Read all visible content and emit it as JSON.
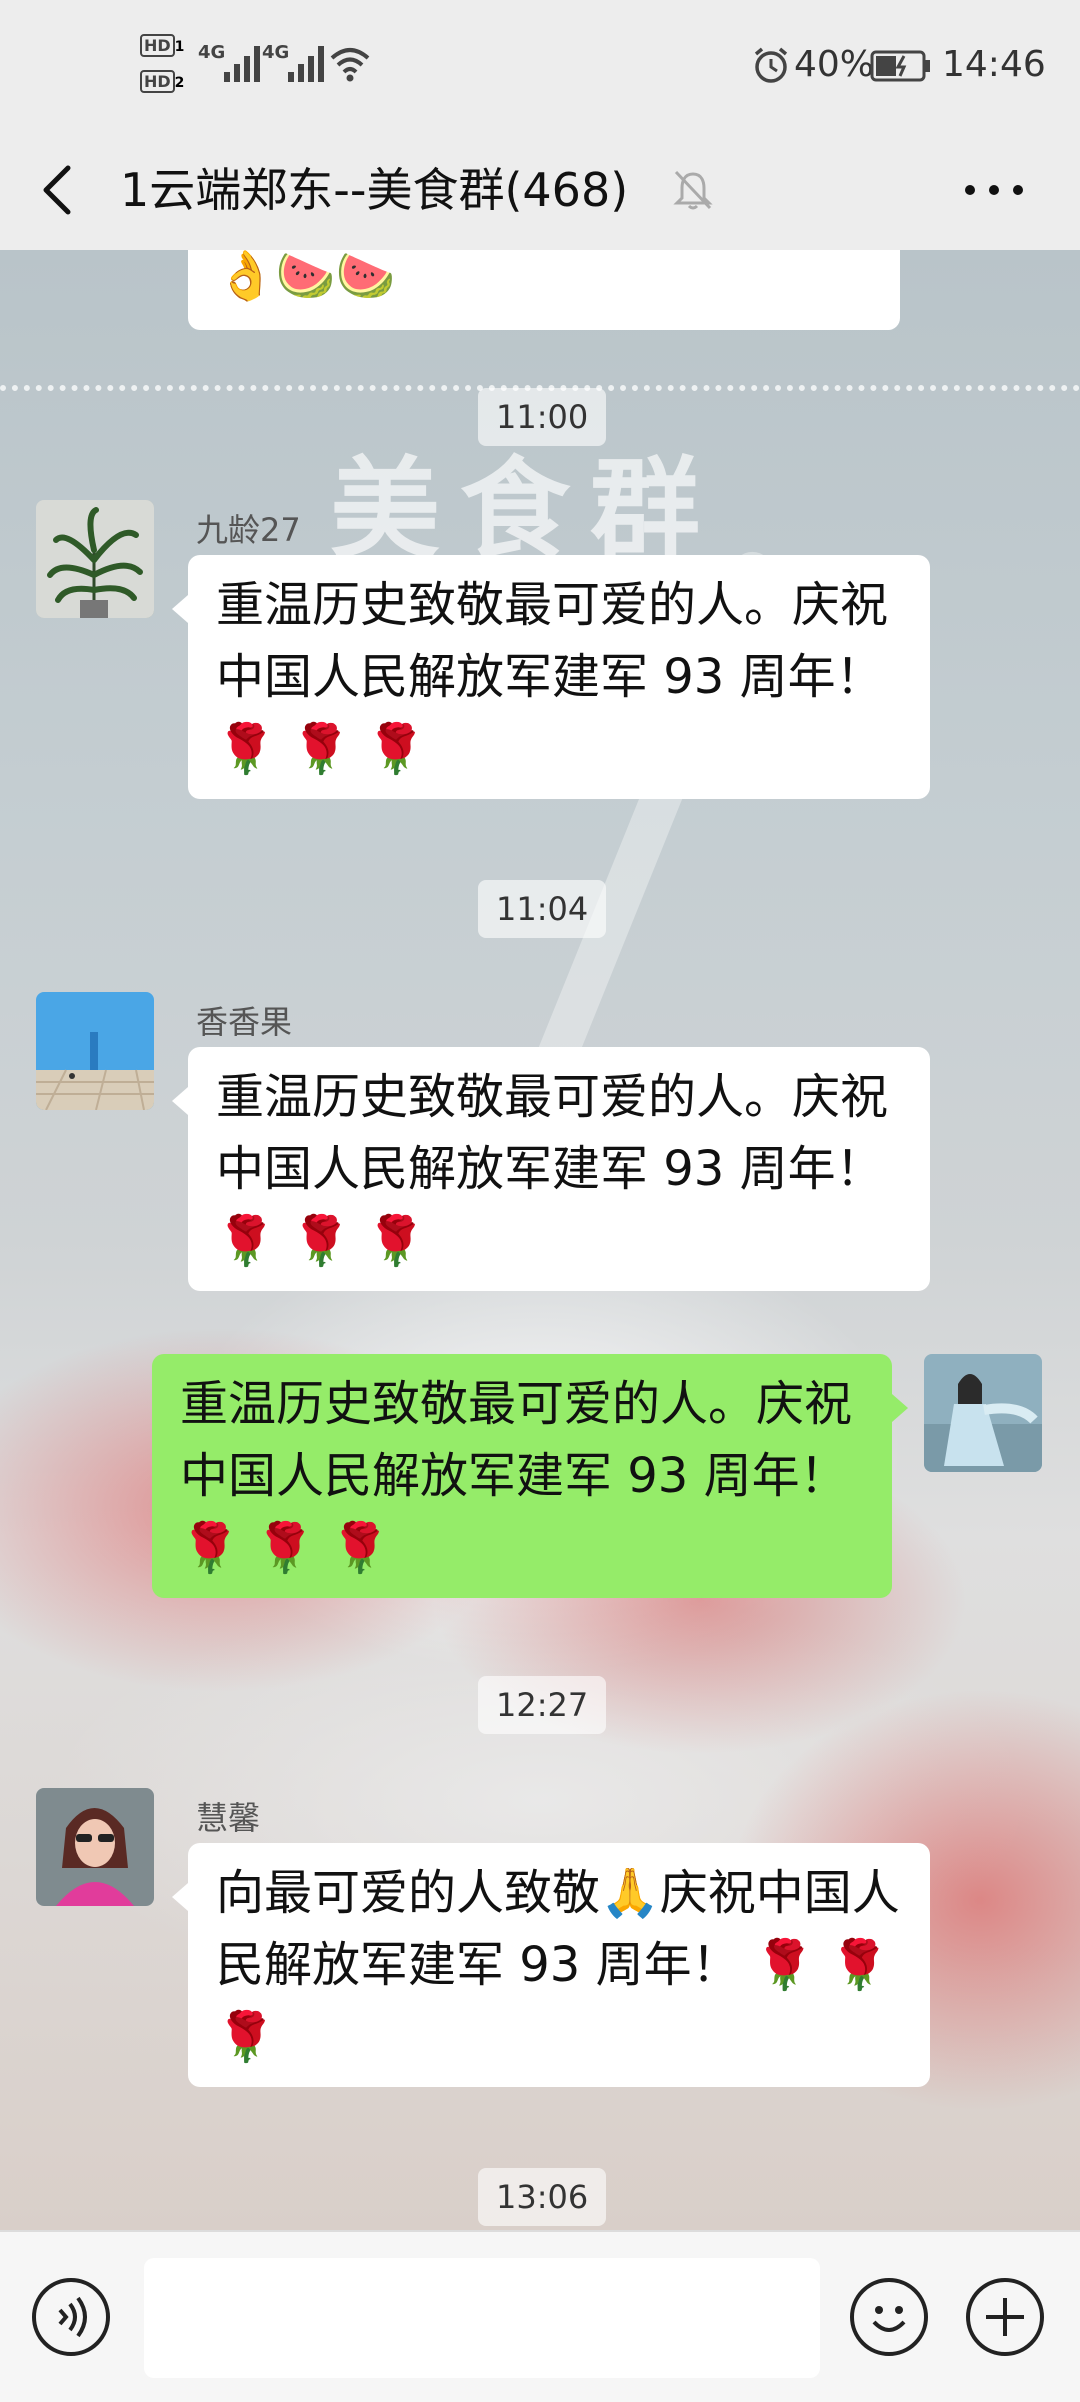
{
  "status_bar": {
    "hd1": "HD",
    "hd1_sub": "1",
    "hd2": "HD",
    "hd2_sub": "2",
    "net1": "4G",
    "net2": "4G",
    "battery": "40%",
    "time": "14:46"
  },
  "header": {
    "title": "1云端郑东--美食群(468)",
    "back_icon": "back-arrow-icon",
    "mute_icon": "bell-muted-icon",
    "more_icon": "more-icon"
  },
  "chat": {
    "partial_bubble_emoji": "👌🍉🍉",
    "watermark": "美食群",
    "timestamps": [
      "11:00",
      "11:04",
      "12:27",
      "13:06"
    ],
    "messages": [
      {
        "sender": "九龄27",
        "text": "重温历史致敬最可爱的人。庆祝中国人民解放军建军 93 周年！ 🌹 🌹 🌹",
        "self": false
      },
      {
        "sender": "香香果",
        "text": "重温历史致敬最可爱的人。庆祝中国人民解放军建军 93 周年！ 🌹 🌹 🌹",
        "self": false
      },
      {
        "sender": "",
        "text": "重温历史致敬最可爱的人。庆祝中国人民解放军建军 93 周年！🌹 🌹 🌹",
        "self": true
      },
      {
        "sender": "慧馨",
        "text": "向最可爱的人致敬🙏庆祝中国人民解放军建军 93 周年！ 🌹 🌹 🌹",
        "self": false
      }
    ]
  },
  "input_bar": {
    "voice_icon": "voice-icon",
    "input_value": "",
    "emoji_icon": "emoji-icon",
    "add_icon": "add-icon"
  }
}
